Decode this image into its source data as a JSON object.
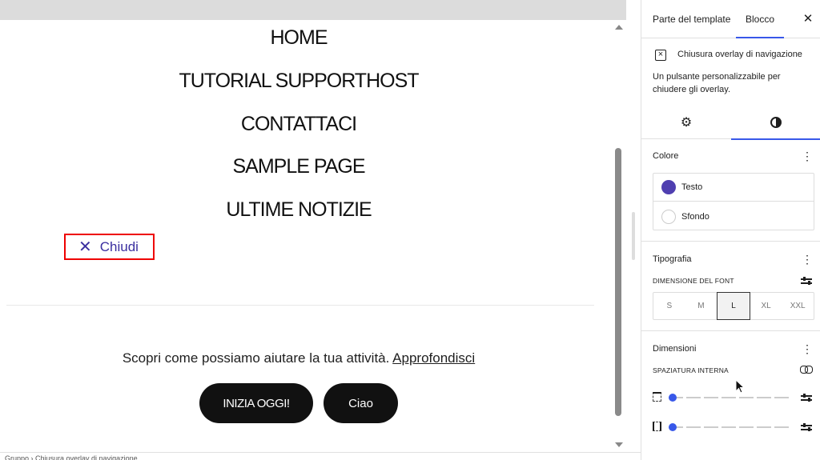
{
  "canvas": {
    "nav_items": [
      "HOME",
      "TUTORIAL SUPPORTHOST",
      "CONTATTACI",
      "SAMPLE PAGE",
      "ULTIME NOTIZIE"
    ],
    "close_button": {
      "icon": "close-icon",
      "label": "Chiudi"
    },
    "promo": {
      "text": "Scopri come possiamo aiutare la tua attività.",
      "link": "Approfondisci"
    },
    "buttons": {
      "start": "INIZIA OGGI!",
      "ciao": "Ciao"
    },
    "footer_breadcrumb": "Gruppo  ›  Chiusura overlay di navigazione"
  },
  "sidebar": {
    "tabs": {
      "template": "Parte del template",
      "block": "Blocco",
      "close": "✕"
    },
    "block": {
      "title": "Chiusura overlay di navigazione",
      "description": "Un pulsante personalizzabile per chiudere gli overlay."
    },
    "color": {
      "title": "Colore",
      "text_label": "Testo",
      "background_label": "Sfondo",
      "text_color": "#4f3fb0"
    },
    "typography": {
      "title": "Tipografia",
      "font_size_label": "DIMENSIONE DEL FONT",
      "sizes": [
        "S",
        "M",
        "L",
        "XL",
        "XXL"
      ],
      "selected_size": "L"
    },
    "dimensions": {
      "title": "Dimensioni",
      "padding_label": "SPAZIATURA INTERNA"
    }
  },
  "accent_color": "#3858e9"
}
